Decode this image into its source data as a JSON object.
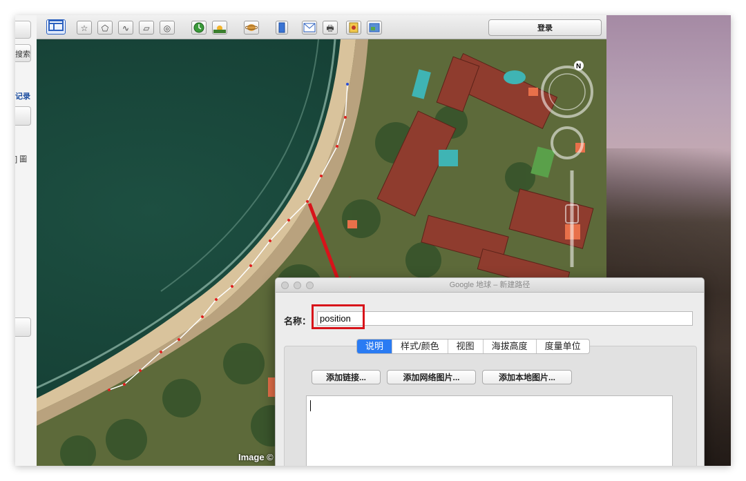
{
  "toolbar": {
    "login_label": "登录"
  },
  "left_panel": {
    "search_fragment": "搜索",
    "history_fragment": "记录",
    "layers_fragment": "] 圖"
  },
  "map": {
    "attribution": "Image ©"
  },
  "dialog": {
    "title": "Google 地球 – 新建路径",
    "name_label": "名称：",
    "name_value": "position",
    "tabs": [
      "说明",
      "样式/颜色",
      "视图",
      "海拔高度",
      "度量单位"
    ],
    "active_tab": "说明",
    "buttons": {
      "add_link": "添加链接...",
      "add_web_image": "添加网络图片...",
      "add_local_image": "添加本地图片..."
    },
    "description_value": ""
  },
  "colors": {
    "highlight": "#d8131a",
    "arrow": "#d8131a",
    "path_line": "#ffffff",
    "path_points": "#e0201f",
    "tab_active": "#2a7bf3"
  },
  "icons": [
    "layout-icon",
    "placemark-icon",
    "polygon-icon",
    "path-icon",
    "overlay-icon",
    "tour-icon",
    "history-icon",
    "sunlight-icon",
    "planet-icon",
    "sidebar-icon",
    "email-icon",
    "print-icon",
    "save-image-icon",
    "map-view-icon",
    "compass-icon"
  ]
}
